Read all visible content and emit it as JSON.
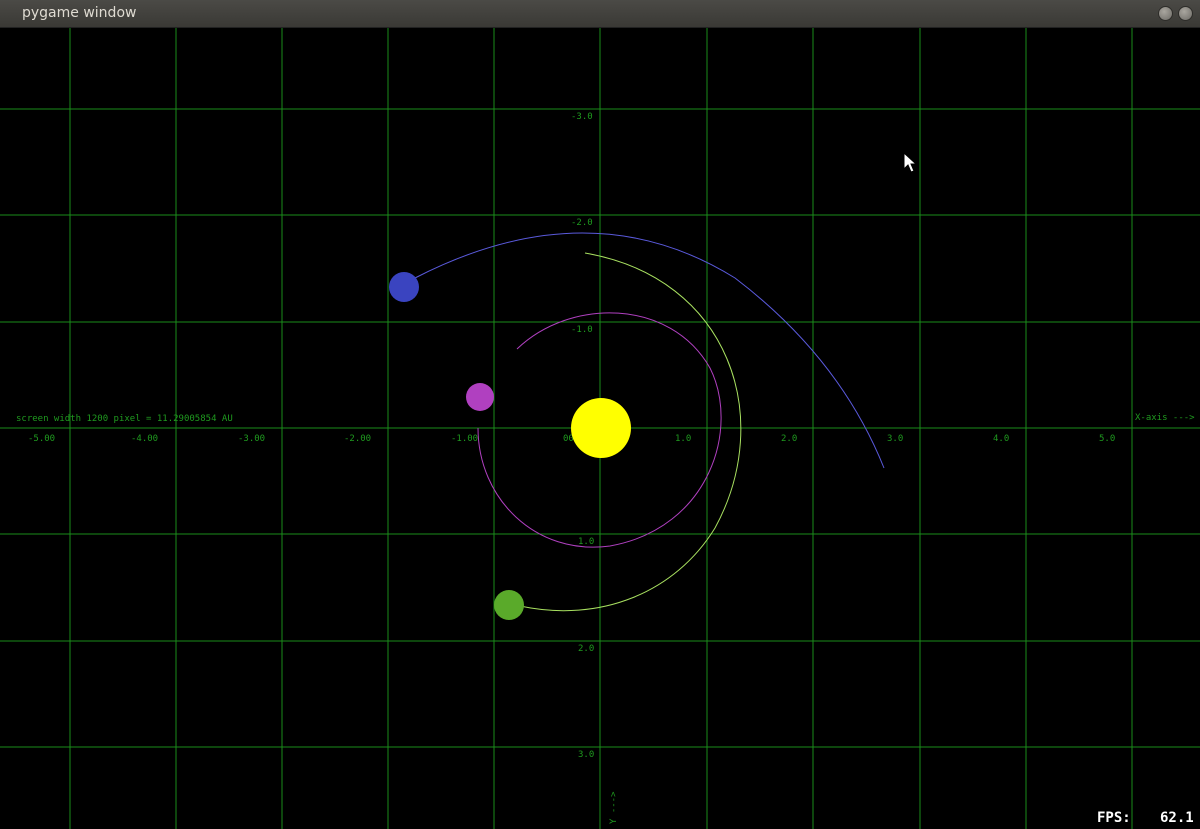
{
  "window": {
    "title": "pygame window"
  },
  "grid": {
    "x_labels": [
      "-5.00",
      "-4.00",
      "-3.00",
      "-2.00",
      "-1.00",
      "00",
      "1.0",
      "2.0",
      "3.0",
      "4.0",
      "5.0"
    ],
    "y_labels": [
      "-3.0",
      "-2.0",
      "-1.0",
      "1.0",
      "2.0",
      "3.0"
    ],
    "x_axis_label": "X-axis --->",
    "y_axis_label": "Y --->",
    "scale_text": "screen width 1200 pixel = 11.29005854 AU",
    "color": "#1a8c1a"
  },
  "bodies": {
    "sun": {
      "color": "#ffff00"
    },
    "inner_planet": {
      "color": "#b040c0",
      "orbit_color": "#b040c0"
    },
    "middle_planet": {
      "color": "#5aaa2a",
      "orbit_color": "#a8e060"
    },
    "outer_planet": {
      "color": "#3a44c0",
      "orbit_color": "#5a5adc"
    }
  },
  "fps": {
    "label": "FPS:",
    "value": "62.1"
  }
}
